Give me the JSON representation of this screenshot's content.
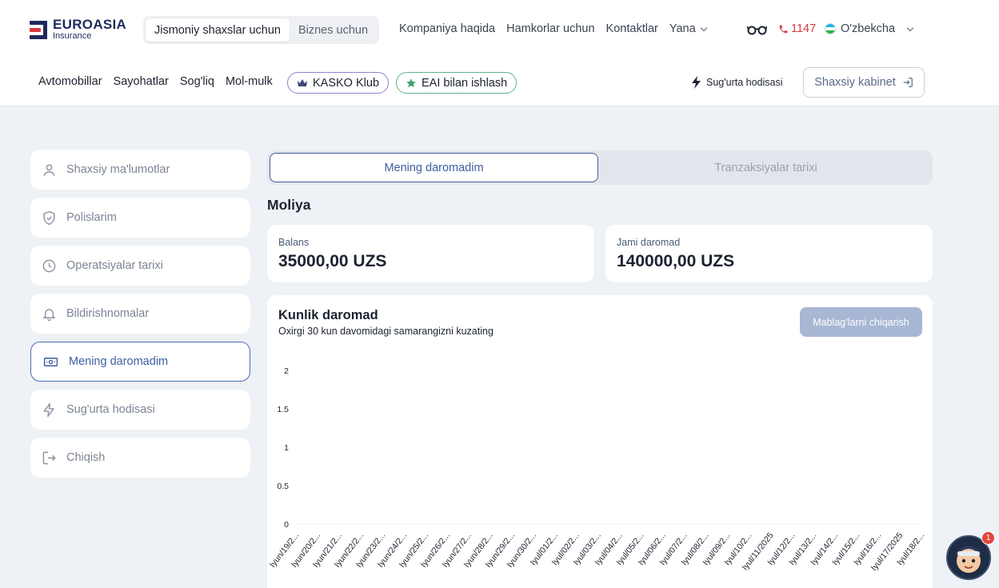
{
  "brand": {
    "name": "EUROASIA",
    "sub": "Insurance"
  },
  "segment": {
    "personal": "Jismoniy shaxslar uchun",
    "business": "Biznes uchun"
  },
  "topnav": {
    "about": "Kompaniya haqida",
    "partners": "Hamkorlar uchun",
    "contacts": "Kontaktlar",
    "more": "Yana"
  },
  "phone": "1147",
  "language": "O'zbekcha",
  "subnav": {
    "cars": "Avtomobillar",
    "travel": "Sayohatlar",
    "health": "Sog'liq",
    "property": "Mol-mulk",
    "kasko": "KASKO Klub",
    "eai": "EAI bilan ishlash"
  },
  "claim_link": "Sug'urta hodisasi",
  "cabinet_button": "Shaxsiy kabinet",
  "sidebar": {
    "items": [
      {
        "label": "Shaxsiy ma'lumotlar",
        "icon": "user-icon"
      },
      {
        "label": "Polislarim",
        "icon": "shield-icon"
      },
      {
        "label": "Operatsiyalar tarixi",
        "icon": "clock-icon"
      },
      {
        "label": "Bildirishnomalar",
        "icon": "bell-icon"
      },
      {
        "label": "Mening daromadim",
        "icon": "money-icon",
        "active": true
      },
      {
        "label": "Sug'urta hodisasi",
        "icon": "lightning-icon"
      },
      {
        "label": "Chiqish",
        "icon": "logout-icon"
      }
    ]
  },
  "tabs": {
    "income": "Mening daromadim",
    "transactions": "Tranzaksiyalar tarixi"
  },
  "finance": {
    "title": "Moliya",
    "balance_label": "Balans",
    "balance_value": "35000,00 UZS",
    "total_label": "Jami daromad",
    "total_value": "140000,00 UZS"
  },
  "daily": {
    "title": "Kunlik daromad",
    "subtitle": "Oxirgi 30 kun davomidagi samarangizni kuzating",
    "withdraw_button": "Mablag'larni chiqarish"
  },
  "chart_data": {
    "type": "line",
    "title": "",
    "xlabel": "",
    "ylabel": "",
    "ylim": [
      0,
      2
    ],
    "yticks": [
      "2",
      "1.5",
      "1",
      "0.5",
      "0"
    ],
    "categories": [
      "Iyun/19/2...",
      "Iyun/20/2...",
      "Iyun/21/2...",
      "Iyun/22/2...",
      "Iyun/23/2...",
      "Iyun/24/2...",
      "Iyun/25/2...",
      "Iyun/26/2...",
      "Iyun/27/2...",
      "Iyun/28/2...",
      "Iyun/29/2...",
      "Iyun/30/2...",
      "Iyul/01/2...",
      "Iyul/02/2...",
      "Iyul/03/2...",
      "Iyul/04/2...",
      "Iyul/05/2...",
      "Iyul/06/2...",
      "Iyul/07/2...",
      "Iyul/08/2...",
      "Iyul/09/2...",
      "Iyul/10/2...",
      "Iyul/11/2025",
      "Iyul/12/2...",
      "Iyul/13/2...",
      "Iyul/14/2...",
      "Iyul/15/2...",
      "Iyul/16/2...",
      "Iyul/17/2025",
      "Iyul/18/2..."
    ],
    "values": [
      0,
      0,
      0,
      0,
      0,
      0,
      0,
      0,
      0,
      0,
      0,
      0,
      0,
      0,
      0,
      0,
      0,
      0,
      0,
      0,
      0,
      0,
      0,
      0,
      0,
      0,
      0,
      0,
      0,
      0
    ],
    "grid": false
  },
  "notification_count": "1",
  "colors": {
    "accent": "#3e5f9f",
    "brand_navy": "#1f2a5c",
    "brand_red": "#d63a3a",
    "kasko_border": "#8b86c9",
    "eai_green": "#5cb58a"
  }
}
